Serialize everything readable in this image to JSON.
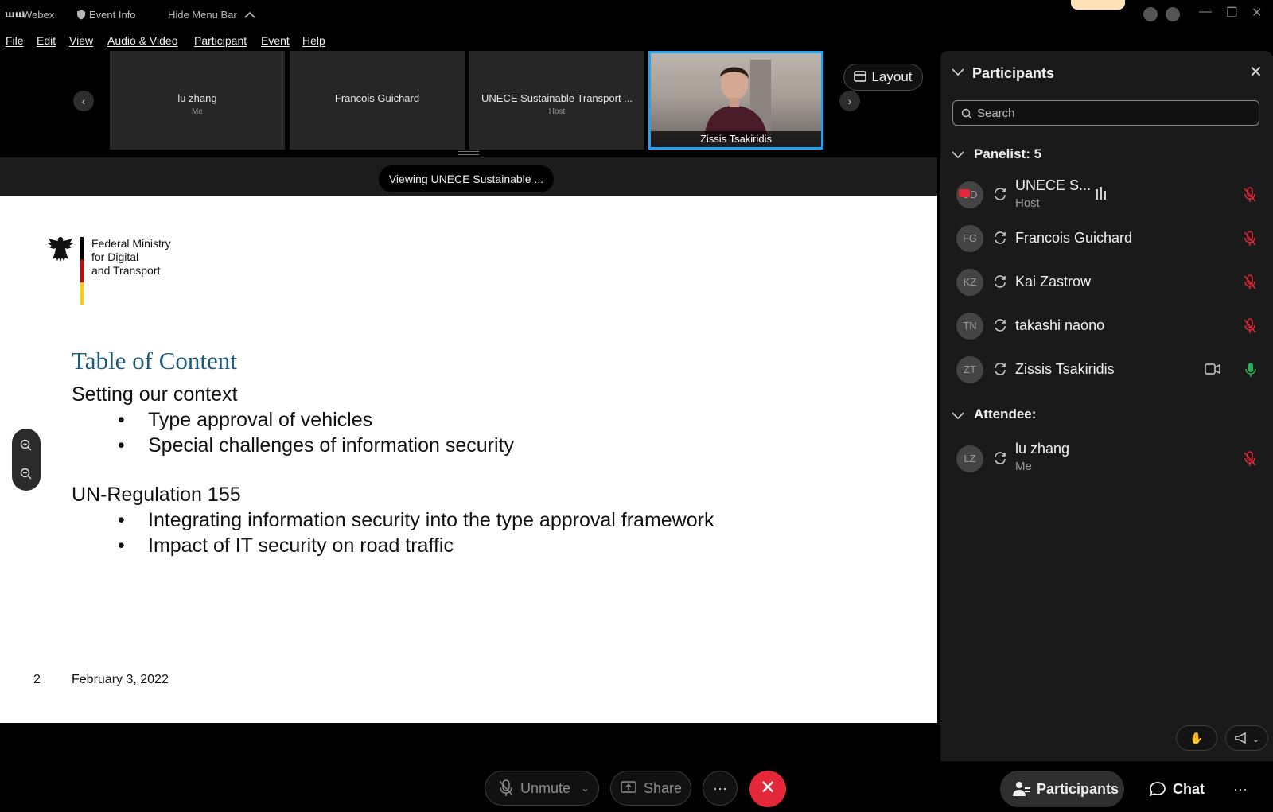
{
  "titlebar": {
    "app_name": "Webex",
    "event_info": "Event Info",
    "hide_menu_bar": "Hide Menu Bar"
  },
  "menu": [
    "File",
    "Edit",
    "View",
    "Audio & Video",
    "Participant",
    "Event",
    "Help"
  ],
  "filmstrip": {
    "tiles": [
      {
        "name": "lu zhang",
        "sub": "Me"
      },
      {
        "name": "Francois Guichard",
        "sub": ""
      },
      {
        "name": "UNECE Sustainable Transport ...",
        "sub": "Host"
      },
      {
        "name": "Zissis Tsakiridis",
        "sub": ""
      }
    ],
    "layout_label": "Layout"
  },
  "share": {
    "viewing_label": "Viewing UNECE Sustainable ..."
  },
  "slide": {
    "ministry_lines": [
      "Federal Ministry",
      "for Digital",
      "and Transport"
    ],
    "title": "Table of Content",
    "section1": "Setting our context",
    "section1_bullets": [
      "Type approval of vehicles",
      "Special challenges of information security"
    ],
    "section2": "UN-Regulation 155",
    "section2_bullets": [
      "Integrating information security into the type approval framework",
      "Impact of IT security on road traffic"
    ],
    "bullet_char": "•",
    "page_number": "2",
    "date": "February 3, 2022"
  },
  "controls": {
    "unmute": "Unmute",
    "share": "Share",
    "more": "···",
    "end": "✕"
  },
  "panel": {
    "title": "Participants",
    "search_placeholder": "Search",
    "panelist_header": "Panelist: 5",
    "attendee_header": "Attendee:",
    "panelists": [
      {
        "initials": "UD",
        "name": "UNECE S...",
        "sub": "Host"
      },
      {
        "initials": "FG",
        "name": "Francois Guichard",
        "sub": ""
      },
      {
        "initials": "KZ",
        "name": "Kai Zastrow",
        "sub": ""
      },
      {
        "initials": "TN",
        "name": "takashi naono",
        "sub": ""
      },
      {
        "initials": "ZT",
        "name": "Zissis Tsakiridis",
        "sub": ""
      }
    ],
    "attendees": [
      {
        "initials": "LZ",
        "name": "lu zhang",
        "sub": "Me"
      }
    ]
  },
  "dock": {
    "participants": "Participants",
    "chat": "Chat",
    "more": "···"
  },
  "colors": {
    "accent_blue": "#1da3f0",
    "end_red": "#e5273a",
    "mute_red": "#e5273a",
    "mic_green": "#25b45a",
    "slide_title": "#1b5a7a"
  }
}
